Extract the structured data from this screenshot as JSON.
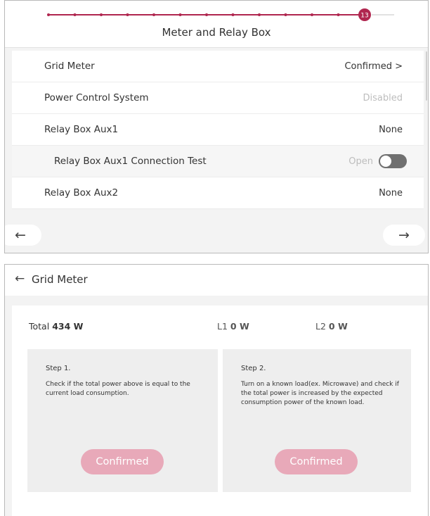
{
  "colors": {
    "accent": "#b0264f",
    "button_disabled": "#e8a9b9"
  },
  "progress": {
    "current_step": "13",
    "total_dots": 13
  },
  "top": {
    "title": "Meter and Relay Box",
    "rows": [
      {
        "label": "Grid Meter",
        "value": "Confirmed >"
      },
      {
        "label": "Power Control System",
        "value": "Disabled"
      },
      {
        "label": "Relay Box Aux1",
        "value": "None"
      },
      {
        "label": "Relay Box Aux1 Connection Test",
        "value": "Open",
        "toggle_on": false
      },
      {
        "label": "Relay Box Aux2",
        "value": "None"
      }
    ],
    "prev_icon": "←",
    "next_icon": "→"
  },
  "grid_meter": {
    "back_icon": "←",
    "title": "Grid Meter",
    "total_label": "Total",
    "total_value": "434 W",
    "l1_label": "L1",
    "l1_value": "0 W",
    "l2_label": "L2",
    "l2_value": "0 W",
    "steps": [
      {
        "title": "Step 1.",
        "description": "Check if the total power above is equal to the current load consumption.",
        "button": "Confirmed"
      },
      {
        "title": "Step 2.",
        "description": "Turn on a known load(ex. Microwave) and check if the total power is increased by the expected consumption power of the known load.",
        "button": "Confirmed"
      }
    ]
  }
}
